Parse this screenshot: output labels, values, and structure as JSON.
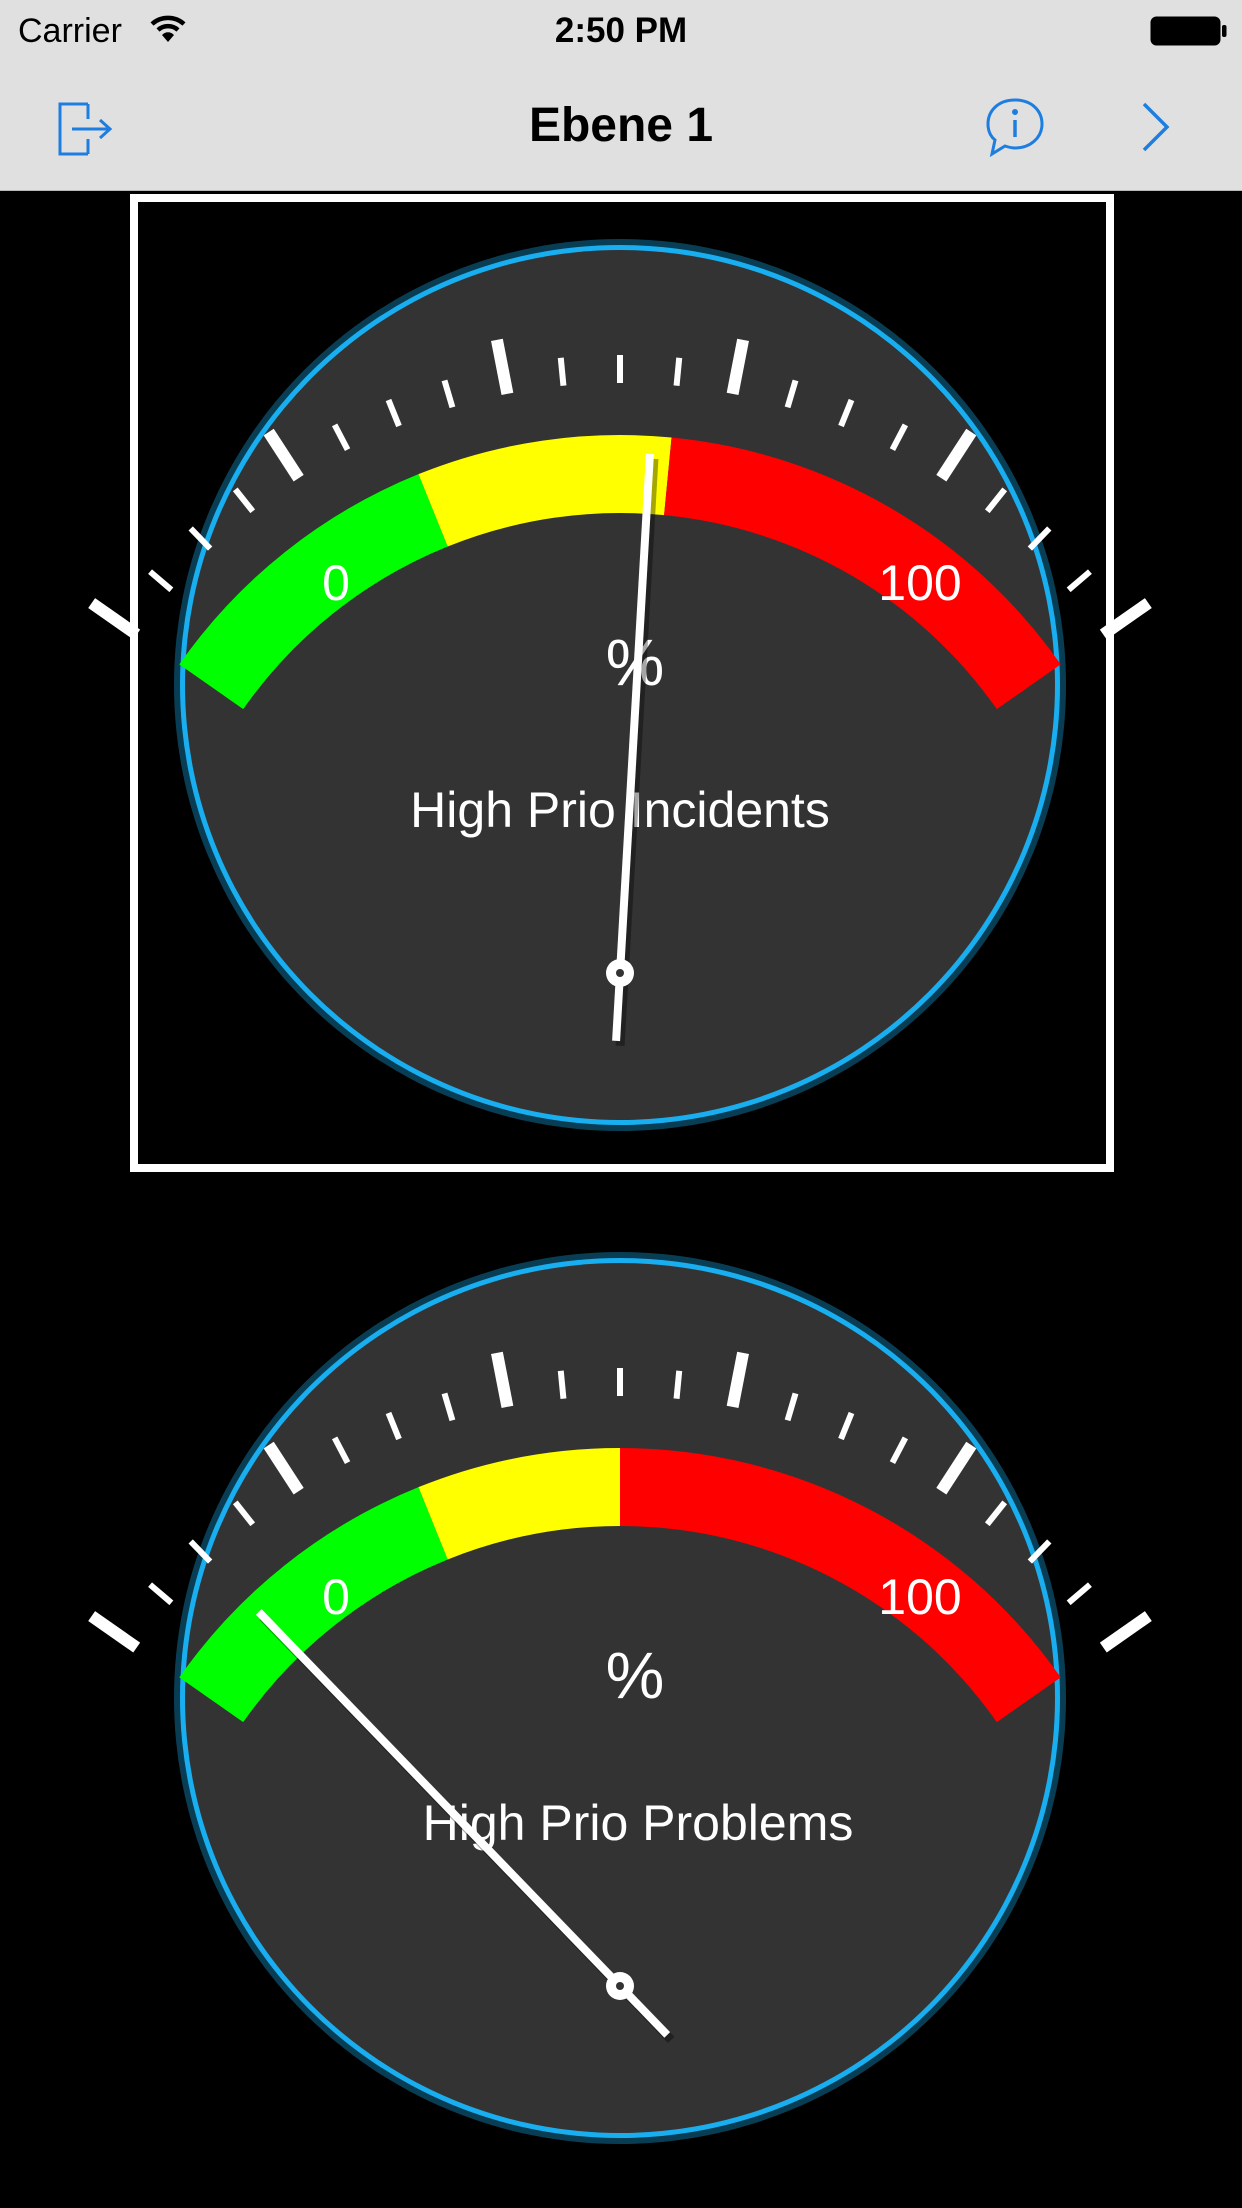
{
  "status_bar": {
    "carrier": "Carrier",
    "time": "2:50 PM",
    "wifi_icon": "wifi-icon",
    "battery_icon": "battery-icon"
  },
  "nav_bar": {
    "title": "Ebene 1",
    "left_icon": "exit-icon",
    "right_icons": [
      "info-bubble-icon",
      "chevron-right-icon"
    ],
    "tint_color": "#1e7ee0"
  },
  "gauges": [
    {
      "title": "High Prio Incidents",
      "unit": "%",
      "min_label": "0",
      "max_label": "100",
      "min": 0,
      "max": 100,
      "value": 53,
      "selected": true,
      "bands": [
        {
          "from": 0,
          "to": 30,
          "color": "#00ff00"
        },
        {
          "from": 30,
          "to": 55,
          "color": "#ffff00"
        },
        {
          "from": 55,
          "to": 100,
          "color": "#ff0000"
        }
      ]
    },
    {
      "title": "High Prio Problems",
      "unit": "%",
      "min_label": "0",
      "max_label": "100",
      "min": 0,
      "max": 100,
      "value": 10,
      "selected": false,
      "bands": [
        {
          "from": 0,
          "to": 30,
          "color": "#00ff00"
        },
        {
          "from": 30,
          "to": 50,
          "color": "#ffff00"
        },
        {
          "from": 50,
          "to": 100,
          "color": "#ff0000"
        }
      ]
    }
  ],
  "colors": {
    "dial_face": "#333333",
    "dial_rim": "#19aef0",
    "background": "#000000",
    "needle": "#ffffff"
  }
}
